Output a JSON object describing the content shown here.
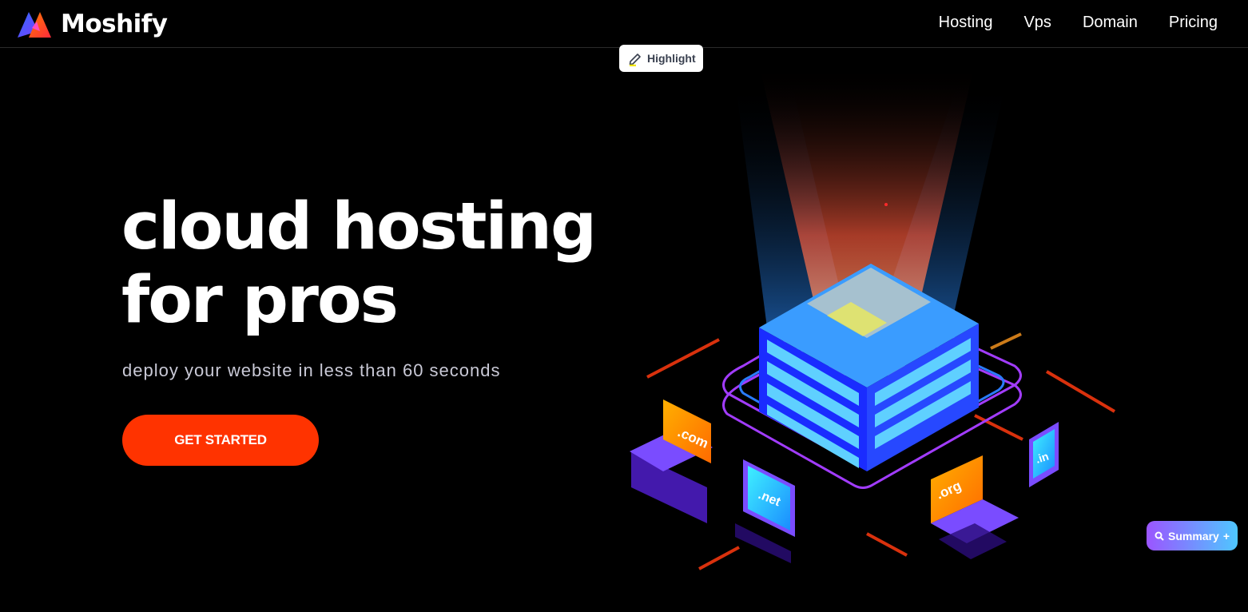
{
  "header": {
    "brand": "Moshify",
    "nav": [
      {
        "label": "Hosting"
      },
      {
        "label": "Vps"
      },
      {
        "label": "Domain"
      },
      {
        "label": "Pricing"
      }
    ]
  },
  "extension": {
    "highlight_label": "Highlight",
    "summary_label": "Summary",
    "summary_plus": "+"
  },
  "hero": {
    "title_line1": "cloud hosting",
    "title_line2": "for pros",
    "subtitle": "deploy your website in less than 60 seconds",
    "cta_label": "GET STARTED"
  },
  "illustration": {
    "domains": [
      ".com",
      ".net",
      ".org",
      ".in"
    ]
  },
  "colors": {
    "background": "#000000",
    "accent": "#ff3300",
    "server_blue": "#1a3cff",
    "device_purple": "#6a3cff"
  }
}
